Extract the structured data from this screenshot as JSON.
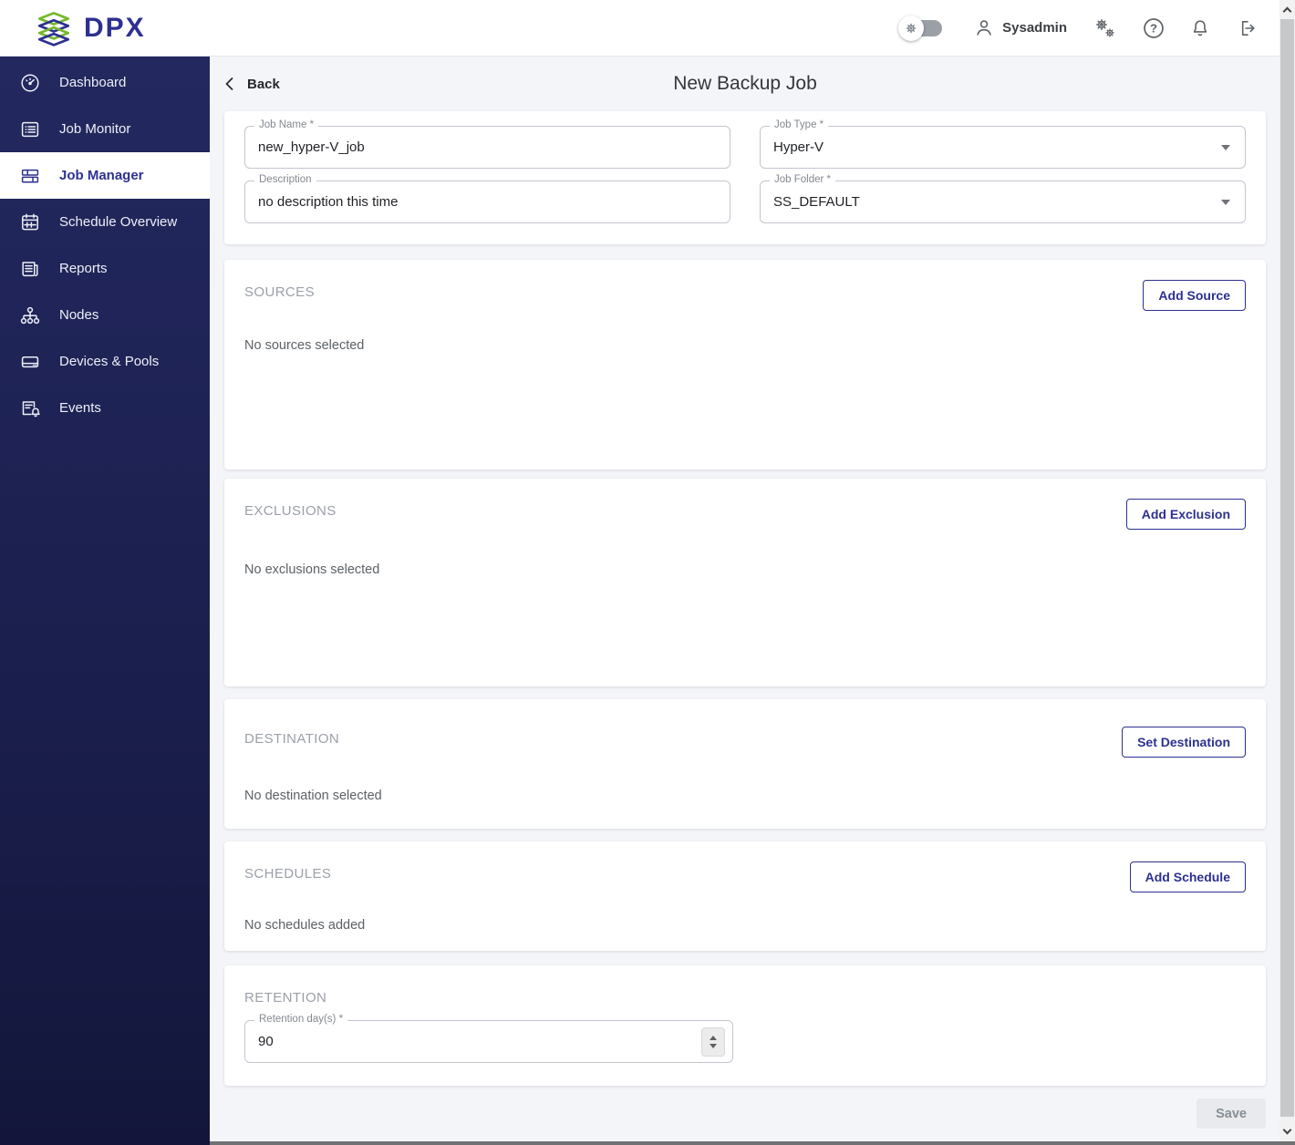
{
  "colors": {
    "accent": "#2d3091",
    "logo_green": "#76b82a",
    "sidebar_top": "#23285f",
    "sidebar_bottom": "#13163a",
    "save_disabled_bg": "#e8eaed"
  },
  "topbar": {
    "brand": "DPX",
    "user": "Sysadmin",
    "icons": [
      "gear-toggle",
      "user-icon",
      "settings-gears-icon",
      "help-icon",
      "notifications-bell-icon",
      "logout-icon"
    ]
  },
  "sidebar": {
    "items": [
      {
        "label": "Dashboard",
        "icon": "dashboard-gauge-icon",
        "active": false
      },
      {
        "label": "Job Monitor",
        "icon": "job-monitor-list-icon",
        "active": false
      },
      {
        "label": "Job Manager",
        "icon": "job-manager-rows-icon",
        "active": true
      },
      {
        "label": "Schedule Overview",
        "icon": "calendar-icon",
        "active": false
      },
      {
        "label": "Reports",
        "icon": "newspaper-icon",
        "active": false
      },
      {
        "label": "Nodes",
        "icon": "sitemap-icon",
        "active": false
      },
      {
        "label": "Devices & Pools",
        "icon": "drive-icon",
        "active": false
      },
      {
        "label": "Events",
        "icon": "list-bell-icon",
        "active": false
      }
    ]
  },
  "page": {
    "back": "Back",
    "title": "New Backup Job"
  },
  "form": {
    "job_name": {
      "label": "Job Name *",
      "value": "new_hyper-V_job"
    },
    "description": {
      "label": "Description",
      "value": "no description this time"
    },
    "job_type": {
      "label": "Job Type *",
      "value": "Hyper-V"
    },
    "job_folder": {
      "label": "Job Folder *",
      "value": "SS_DEFAULT"
    }
  },
  "sections": {
    "sources": {
      "title": "SOURCES",
      "button": "Add Source",
      "empty": "No sources selected"
    },
    "exclusions": {
      "title": "EXCLUSIONS",
      "button": "Add Exclusion",
      "empty": "No exclusions selected"
    },
    "destination": {
      "title": "DESTINATION",
      "button": "Set Destination",
      "empty": "No destination selected"
    },
    "schedules": {
      "title": "SCHEDULES",
      "button": "Add Schedule",
      "empty": "No schedules added"
    },
    "retention": {
      "title": "RETENTION",
      "field_label": "Retention day(s) *",
      "value": "90"
    }
  },
  "footer": {
    "save": "Save"
  }
}
